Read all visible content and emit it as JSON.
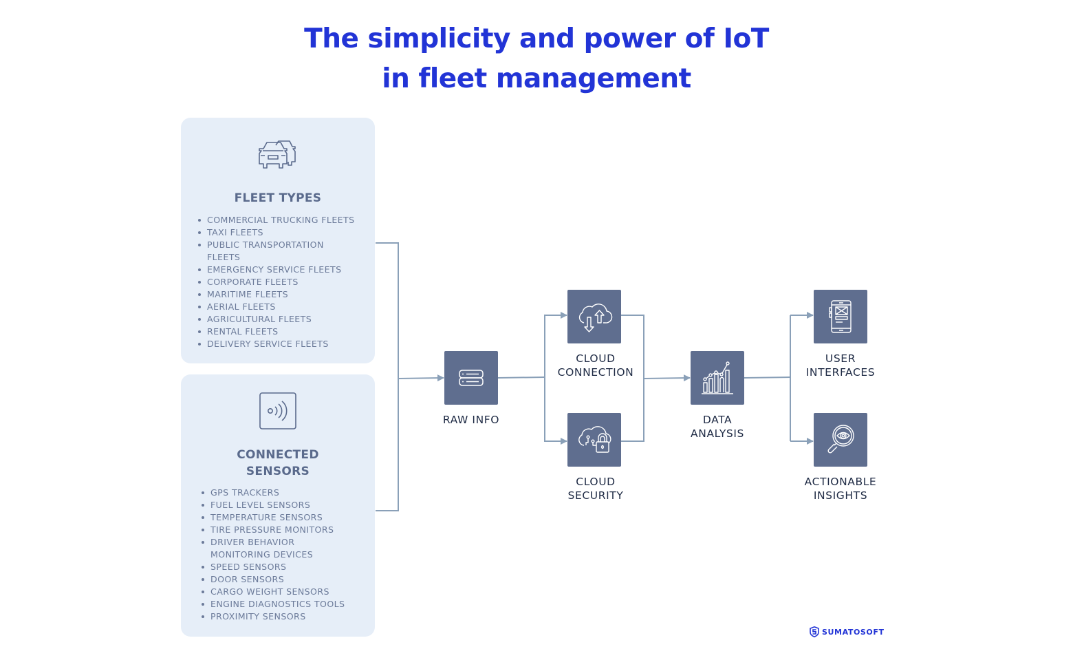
{
  "title": {
    "line1": "The simplicity and power of IoT",
    "line2": "in fleet management"
  },
  "colors": {
    "title": "#2234d6",
    "card_bg": "#e6eef8",
    "card_text": "#6b7a99",
    "node_bg": "#5f6e8f",
    "connector": "#8aa0b8",
    "label": "#1e2a44"
  },
  "cards": {
    "fleet_types": {
      "icon": "cars-icon",
      "heading": "FLEET TYPES",
      "items": [
        "COMMERCIAL TRUCKING FLEETS",
        "TAXI FLEETS",
        "PUBLIC TRANSPORTATION FLEETS",
        "EMERGENCY SERVICE FLEETS",
        "CORPORATE FLEETS",
        "MARITIME FLEETS",
        "AERIAL FLEETS",
        "AGRICULTURAL FLEETS",
        "RENTAL FLEETS",
        "DELIVERY SERVICE FLEETS"
      ]
    },
    "connected_sensors": {
      "icon": "sensor-signal-icon",
      "heading_line1": "CONNECTED",
      "heading_line2": "SENSORS",
      "items": [
        "GPS TRACKERS",
        "FUEL LEVEL SENSORS",
        "TEMPERATURE SENSORS",
        "TIRE PRESSURE MONITORS",
        "DRIVER BEHAVIOR MONITORING DEVICES",
        "SPEED SENSORS",
        "DOOR SENSORS",
        "CARGO WEIGHT SENSORS",
        "ENGINE DIAGNOSTICS TOOLS",
        "PROXIMITY SENSORS"
      ]
    }
  },
  "nodes": {
    "raw_info": {
      "icon": "server-icon",
      "line1": "RAW INFO",
      "line2": ""
    },
    "cloud_connection": {
      "icon": "cloud-sync-icon",
      "line1": "CLOUD",
      "line2": "CONNECTION"
    },
    "cloud_security": {
      "icon": "cloud-lock-icon",
      "line1": "CLOUD",
      "line2": "SECURITY"
    },
    "data_analysis": {
      "icon": "bar-chart-icon",
      "line1": "DATA",
      "line2": "ANALYSIS"
    },
    "user_interfaces": {
      "icon": "mobile-wireframe-icon",
      "line1": "USER",
      "line2": "INTERFACES"
    },
    "actionable_insights": {
      "icon": "magnifier-eye-icon",
      "line1": "ACTIONABLE",
      "line2": "INSIGHTS"
    }
  },
  "flow": [
    [
      "fleet_types",
      "raw_info"
    ],
    [
      "connected_sensors",
      "raw_info"
    ],
    [
      "raw_info",
      "cloud_connection"
    ],
    [
      "raw_info",
      "cloud_security"
    ],
    [
      "cloud_connection",
      "data_analysis"
    ],
    [
      "cloud_security",
      "data_analysis"
    ],
    [
      "data_analysis",
      "user_interfaces"
    ],
    [
      "data_analysis",
      "actionable_insights"
    ]
  ],
  "brand": {
    "name": "SUMATOSOFT",
    "icon": "shield-s-logo-icon"
  }
}
